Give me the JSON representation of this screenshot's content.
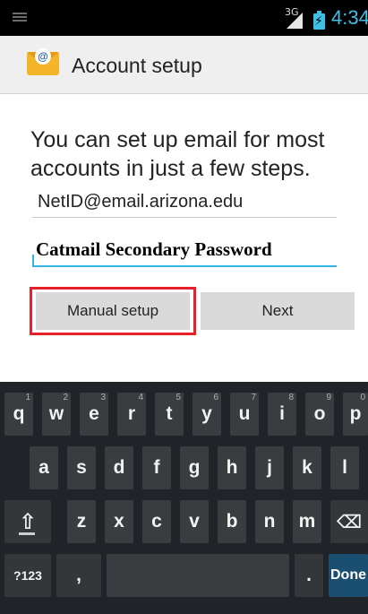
{
  "status_bar": {
    "network": "3G",
    "time": "4:34",
    "battery_icon": "battery-charging-icon",
    "signal_icon": "signal-icon"
  },
  "action_bar": {
    "title": "Account setup",
    "app_icon": "email-app-icon"
  },
  "form": {
    "intro": "You can set up email for most accounts in just a few steps.",
    "email_value": "NetID@email.arizona.edu",
    "password_value": "Catmail Secondary Password"
  },
  "buttons": {
    "manual_setup": "Manual setup",
    "next": "Next"
  },
  "keyboard": {
    "row1": [
      {
        "label": "q",
        "hint": "1"
      },
      {
        "label": "w",
        "hint": "2"
      },
      {
        "label": "e",
        "hint": "3"
      },
      {
        "label": "r",
        "hint": "4"
      },
      {
        "label": "t",
        "hint": "5"
      },
      {
        "label": "y",
        "hint": "6"
      },
      {
        "label": "u",
        "hint": "7"
      },
      {
        "label": "i",
        "hint": "8"
      },
      {
        "label": "o",
        "hint": "9"
      },
      {
        "label": "p",
        "hint": "0"
      }
    ],
    "row2": [
      "a",
      "s",
      "d",
      "f",
      "g",
      "h",
      "j",
      "k",
      "l"
    ],
    "row3": [
      "z",
      "x",
      "c",
      "v",
      "b",
      "n",
      "m"
    ],
    "symbols_label": "?123",
    "comma_label": ",",
    "period_label": ".",
    "done_label": "Done",
    "shift_icon": "shift-icon",
    "backspace_icon": "backspace-icon"
  }
}
